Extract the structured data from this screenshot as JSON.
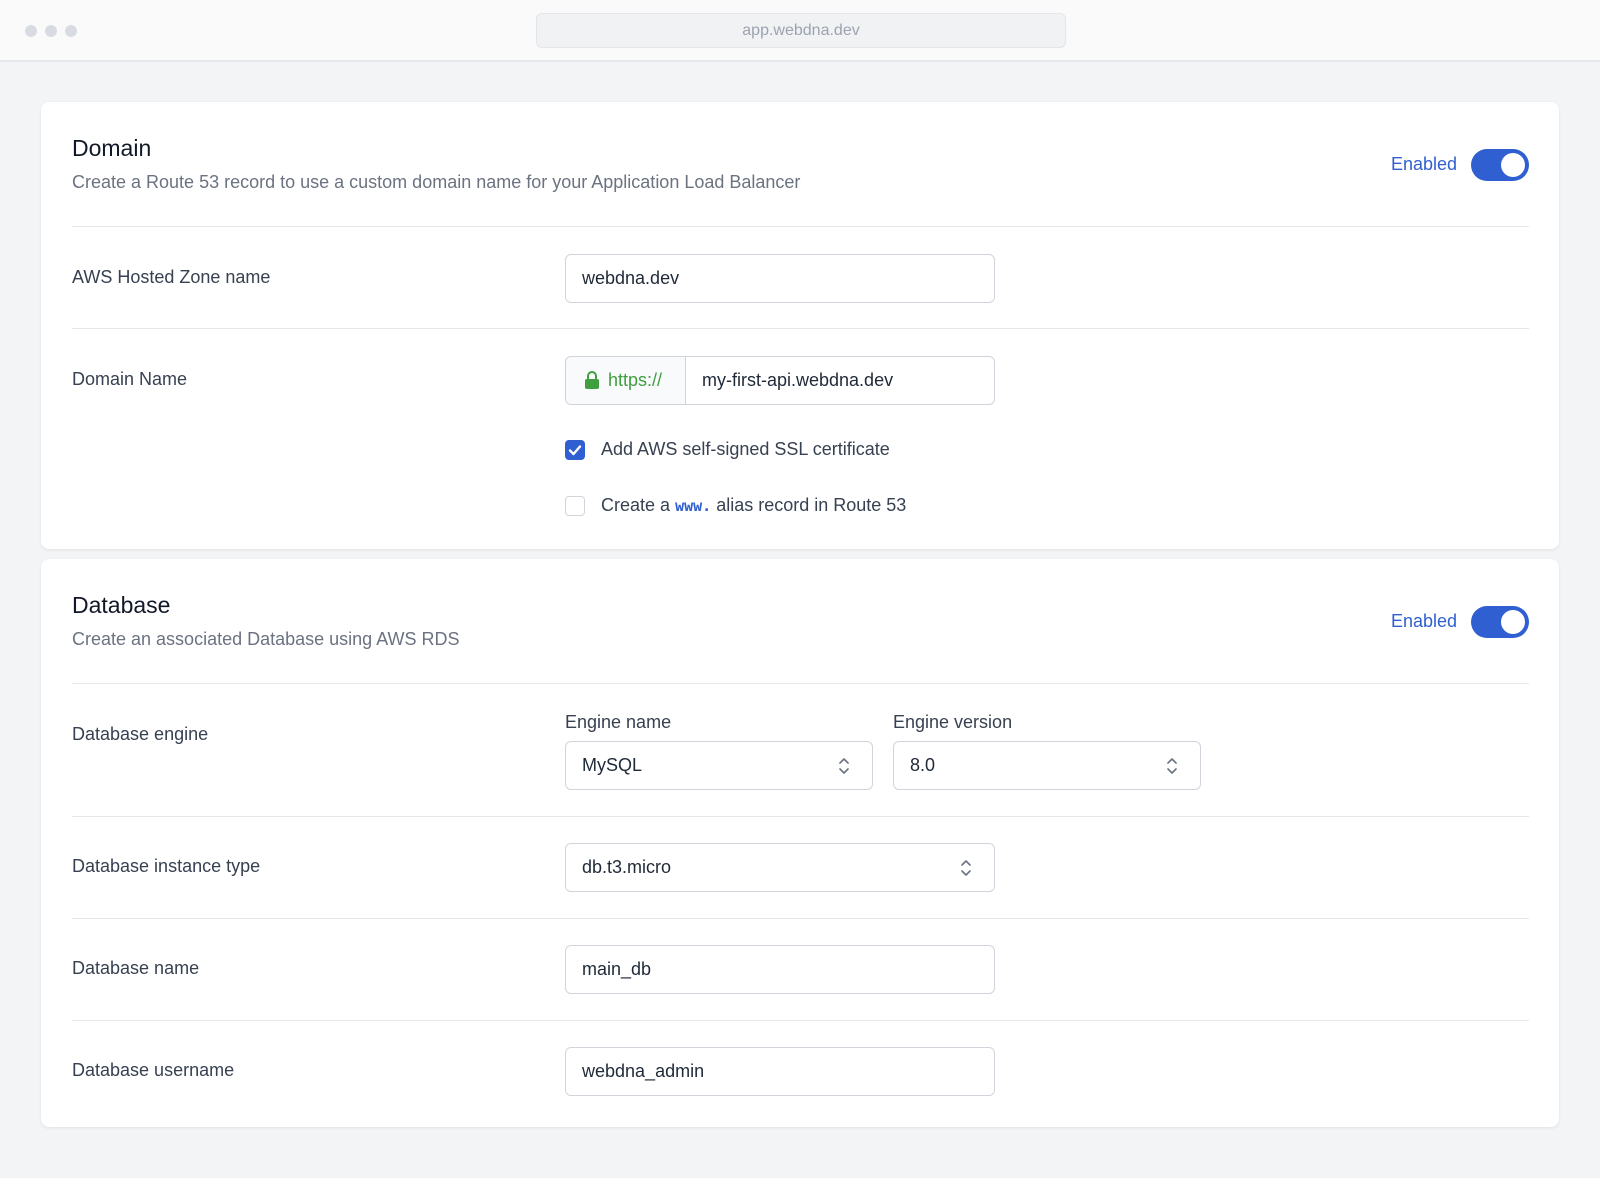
{
  "browser": {
    "url": "app.webdna.dev"
  },
  "domain_card": {
    "title": "Domain",
    "description": "Create a Route 53 record to use a custom domain name for your Application Load Balancer",
    "toggle_label": "Enabled",
    "hosted_zone": {
      "label": "AWS Hosted Zone name",
      "value": "webdna.dev"
    },
    "domain_name": {
      "label": "Domain Name",
      "prefix": "https://",
      "value": "my-first-api.webdna.dev"
    },
    "ssl_checkbox": {
      "label": "Add AWS self-signed SSL certificate",
      "checked": true
    },
    "www_checkbox": {
      "label_before": "Create a",
      "code": "www.",
      "label_after": "alias record in Route 53",
      "checked": false
    }
  },
  "database_card": {
    "title": "Database",
    "description": "Create an associated Database using AWS RDS",
    "toggle_label": "Enabled",
    "engine": {
      "label": "Database engine",
      "engine_name_label": "Engine name",
      "engine_name_value": "MySQL",
      "engine_version_label": "Engine version",
      "engine_version_value": "8.0"
    },
    "instance_type": {
      "label": "Database instance type",
      "value": "db.t3.micro"
    },
    "db_name": {
      "label": "Database name",
      "value": "main_db"
    },
    "db_username": {
      "label": "Database username",
      "value": "webdna_admin"
    }
  },
  "colors": {
    "accent": "#2f5fd0",
    "secure": "#3f9f3f",
    "background": "#f3f4f6"
  }
}
